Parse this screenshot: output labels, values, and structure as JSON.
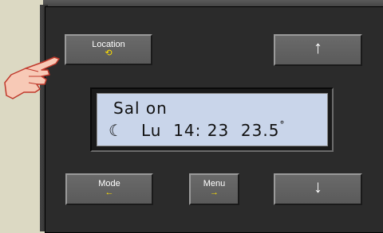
{
  "buttons": {
    "location": {
      "label": "Location",
      "sub_icon": "⟲"
    },
    "up": {
      "arrow": "↑"
    },
    "mode": {
      "label": "Mode",
      "sub_icon": "←"
    },
    "menu": {
      "label": "Menu",
      "sub_icon": "→"
    },
    "down": {
      "arrow": "↓"
    }
  },
  "lcd": {
    "line1": "Sal on",
    "moon_icon": "☾",
    "day": "Lu",
    "time": "14: 23",
    "temperature": "23.5",
    "degree_symbol": "°"
  },
  "colors": {
    "background": "#dcd9c3",
    "panel": "#2b2b2b",
    "lcd_bg": "#c9d5ea",
    "accent_yellow": "#ffe000"
  }
}
